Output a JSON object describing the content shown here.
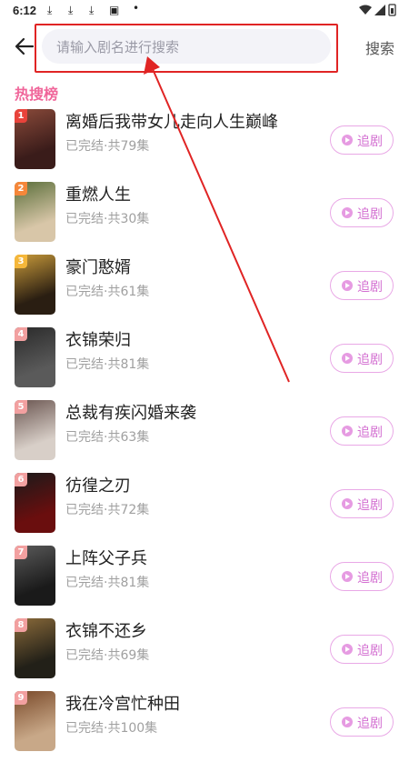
{
  "status_bar": {
    "time": "6:12",
    "dl_icons": [
      "download-icon",
      "download-icon",
      "download-icon",
      "notice-icon"
    ]
  },
  "header": {
    "search_placeholder": "请输入剧名进行搜索",
    "search_button": "搜索"
  },
  "section": {
    "title": "热搜榜"
  },
  "list": {
    "follow_label": "追剧",
    "items": [
      {
        "rank": "1",
        "title": "离婚后我带女儿走向人生巅峰",
        "meta": "已完结·共79集",
        "poster_color": "#3a1c1a",
        "poster_color2": "#8a4a3a"
      },
      {
        "rank": "2",
        "title": "重燃人生",
        "meta": "已完结·共30集",
        "poster_color": "#d8c6a8",
        "poster_color2": "#5a6e3a"
      },
      {
        "rank": "3",
        "title": "豪门憨婿",
        "meta": "已完结·共61集",
        "poster_color": "#2a1e12",
        "poster_color2": "#c89a3a"
      },
      {
        "rank": "4",
        "title": "衣锦荣归",
        "meta": "已完结·共81集",
        "poster_color": "#5a5a5a",
        "poster_color2": "#2a2a2a"
      },
      {
        "rank": "5",
        "title": "总裁有疾闪婚来袭",
        "meta": "已完结·共63集",
        "poster_color": "#d8cfc8",
        "poster_color2": "#6a5550"
      },
      {
        "rank": "6",
        "title": "彷徨之刃",
        "meta": "已完结·共72集",
        "poster_color": "#6a0e0e",
        "poster_color2": "#1a1a1a"
      },
      {
        "rank": "7",
        "title": "上阵父子兵",
        "meta": "已完结·共81集",
        "poster_color": "#1a1a1a",
        "poster_color2": "#5a5a5a"
      },
      {
        "rank": "8",
        "title": "衣锦不还乡",
        "meta": "已完结·共69集",
        "poster_color": "#222018",
        "poster_color2": "#8a6a3a"
      },
      {
        "rank": "9",
        "title": "我在冷宫忙种田",
        "meta": "已完结·共100集",
        "poster_color": "#c8a888",
        "poster_color2": "#7a4a2a"
      }
    ]
  }
}
